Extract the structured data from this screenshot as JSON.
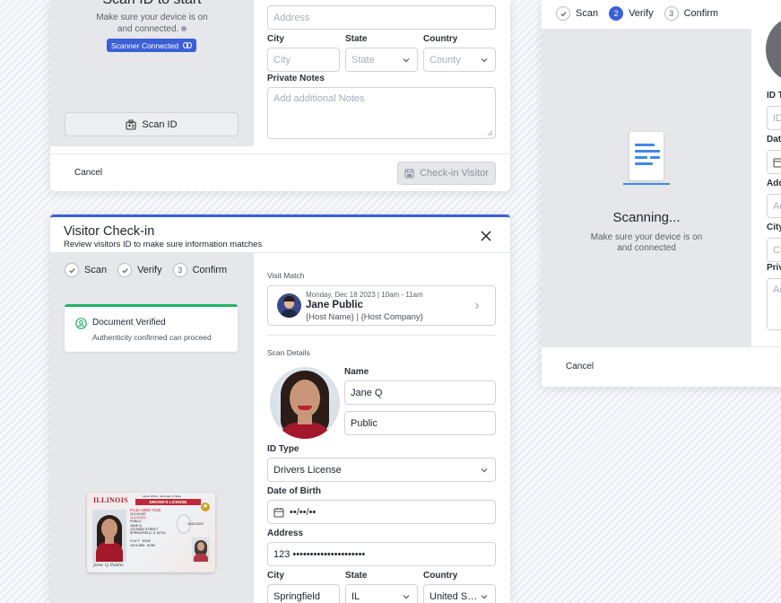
{
  "top_left_panel": {
    "scan_title": "Scan ID to start",
    "scan_desc_line1": "Make sure your device is on",
    "scan_desc_line2": "and connected.",
    "scanner_badge": "Scanner Connected",
    "scan_id_button": "Scan ID",
    "address_placeholder": "Address",
    "city_label": "City",
    "state_label": "State",
    "country_label": "Country",
    "city_placeholder": "City",
    "state_placeholder": "State",
    "country_placeholder": "County",
    "notes_label": "Private Notes",
    "notes_placeholder": "Add additional Notes",
    "cancel_button": "Cancel",
    "checkin_button": "Check-in Visitor"
  },
  "main_panel": {
    "title": "Visitor Check-in",
    "subtitle": "Review visitors ID to make sure information matches",
    "steps": [
      {
        "label": "Scan",
        "marker": "check"
      },
      {
        "label": "Verify",
        "marker": "check"
      },
      {
        "label": "Confirm",
        "marker": "3"
      }
    ],
    "verified_title": "Document Verified",
    "verified_desc": "Authenticity confirmed can proceed",
    "visit_match_label": "Visit Match",
    "visit": {
      "datetime": "Monday, Dec 18 2023 | 10am - 11am",
      "name": "Jane Public",
      "host": "{Host Name} | {Host Company}"
    },
    "scan_details_label": "Scan Details",
    "name_label": "Name",
    "first_name": "Jane Q",
    "last_name": "Public",
    "id_type_label": "ID Type",
    "id_type_value": "Drivers License",
    "dob_label": "Date of Birth",
    "dob_value": "••/••/••",
    "address_label": "Address",
    "address_value": "123 •••••••••••••••••••••",
    "city_label": "City",
    "state_label": "State",
    "country_label": "Country",
    "city_value": "Springfield",
    "state_value": "IL",
    "country_value": "United States",
    "license": {
      "state": "ILLINOIS",
      "secretary": "Jesse White • Secretary of State",
      "type": "DRIVER'S LICENSE",
      "number": "P142-4590-7026",
      "dob": "11/14/1997",
      "exp": "11/14/2023",
      "name1": "PUBLIC",
      "name2": "JANE Q",
      "street": "123 MAIN STREET",
      "city": "SPRINGFIELD, IL 62701",
      "iss": "11/01/2019",
      "endorse": "NONE",
      "restr": "NONE",
      "ht": "5'-04\"",
      "sex": "F",
      "wt": "145 lb",
      "eyes": "BRN",
      "sig": "Jane Q Public"
    }
  },
  "right_panel": {
    "steps": [
      {
        "label": "Scan",
        "marker": "check"
      },
      {
        "label": "Verify",
        "marker": "2"
      },
      {
        "label": "Confirm",
        "marker": "3"
      }
    ],
    "scanning_title": "Scanning...",
    "scanning_desc_line1": "Make sure your device is on",
    "scanning_desc_line2": "and connected",
    "labels": [
      "ID T",
      "Dat",
      "Add",
      "City",
      "Priv"
    ],
    "placeholders": [
      "ID",
      "Ad",
      "Ci",
      "Ad"
    ],
    "cancel_button": "Cancel"
  },
  "colors": {
    "accent": "#3b5fd6",
    "success": "#22b26b",
    "scanner_badge": "#3b5fd6"
  }
}
